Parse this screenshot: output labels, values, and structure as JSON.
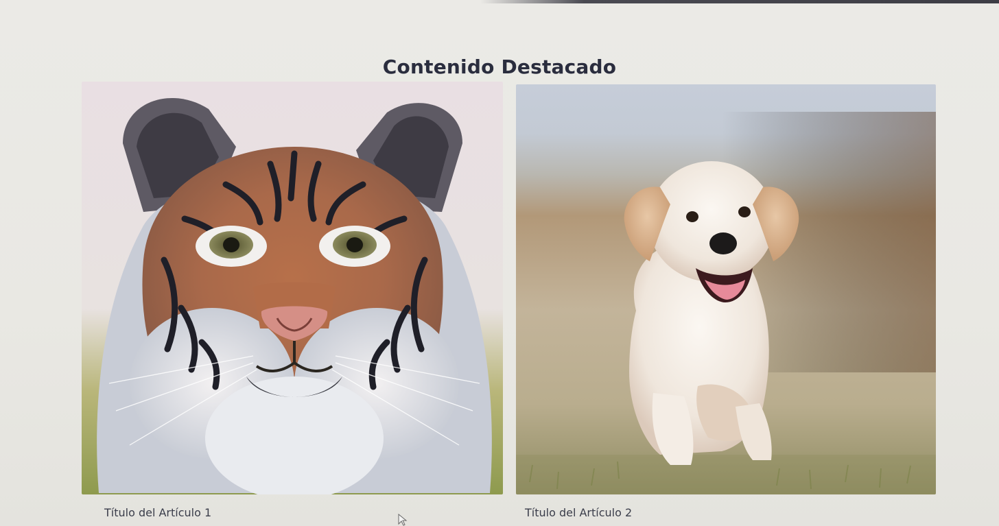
{
  "page": {
    "title": "Contenido Destacado"
  },
  "articles": [
    {
      "title": "Título del Artículo 1",
      "image": "tiger-face-photo"
    },
    {
      "title": "Título del Artículo 2",
      "image": "puppy-running-photo"
    }
  ],
  "colors": {
    "background": "#e9e8e3",
    "title_text": "#2a2d3e",
    "caption_text": "#3a3d4a"
  }
}
